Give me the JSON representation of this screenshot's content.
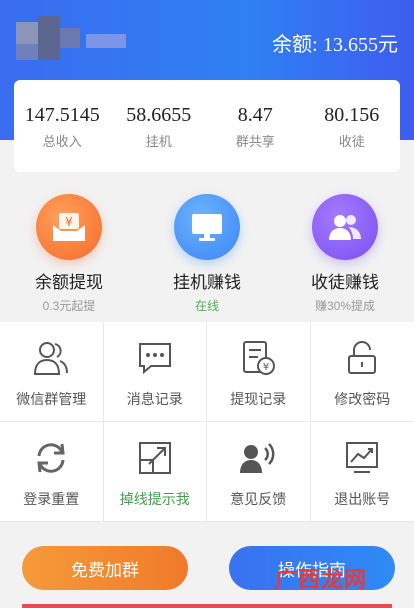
{
  "header": {
    "balance_label": "余额:",
    "balance_value": "13.655元"
  },
  "stats": [
    {
      "value": "147.5145",
      "label": "总收入"
    },
    {
      "value": "58.6655",
      "label": "挂机"
    },
    {
      "value": "8.47",
      "label": "群共享"
    },
    {
      "value": "80.156",
      "label": "收徒"
    }
  ],
  "actions": [
    {
      "title": "余额提现",
      "sub": "0.3元起提",
      "icon": "wallet-yen-icon",
      "color": "#f56a2a"
    },
    {
      "title": "挂机赚钱",
      "sub": "在线",
      "icon": "monitor-icon",
      "color": "#3b84f4",
      "sub_color": "#4caf50"
    },
    {
      "title": "收徒赚钱",
      "sub": "赚30%提成",
      "icon": "people-icon",
      "color": "#7a4ff0"
    }
  ],
  "grid": [
    {
      "label": "微信群管理",
      "icon": "group-manage-icon"
    },
    {
      "label": "消息记录",
      "icon": "message-icon"
    },
    {
      "label": "提现记录",
      "icon": "withdraw-record-icon"
    },
    {
      "label": "修改密码",
      "icon": "lock-icon"
    },
    {
      "label": "登录重置",
      "icon": "refresh-icon"
    },
    {
      "label": "掉线提示我",
      "icon": "resize-alert-icon",
      "label_color": "#43a047"
    },
    {
      "label": "意见反馈",
      "icon": "feedback-icon"
    },
    {
      "label": "退出账号",
      "icon": "chart-exit-icon"
    }
  ],
  "buttons": {
    "join_group": "免费加群",
    "guide": "操作指南"
  },
  "watermark": "广西龙网"
}
